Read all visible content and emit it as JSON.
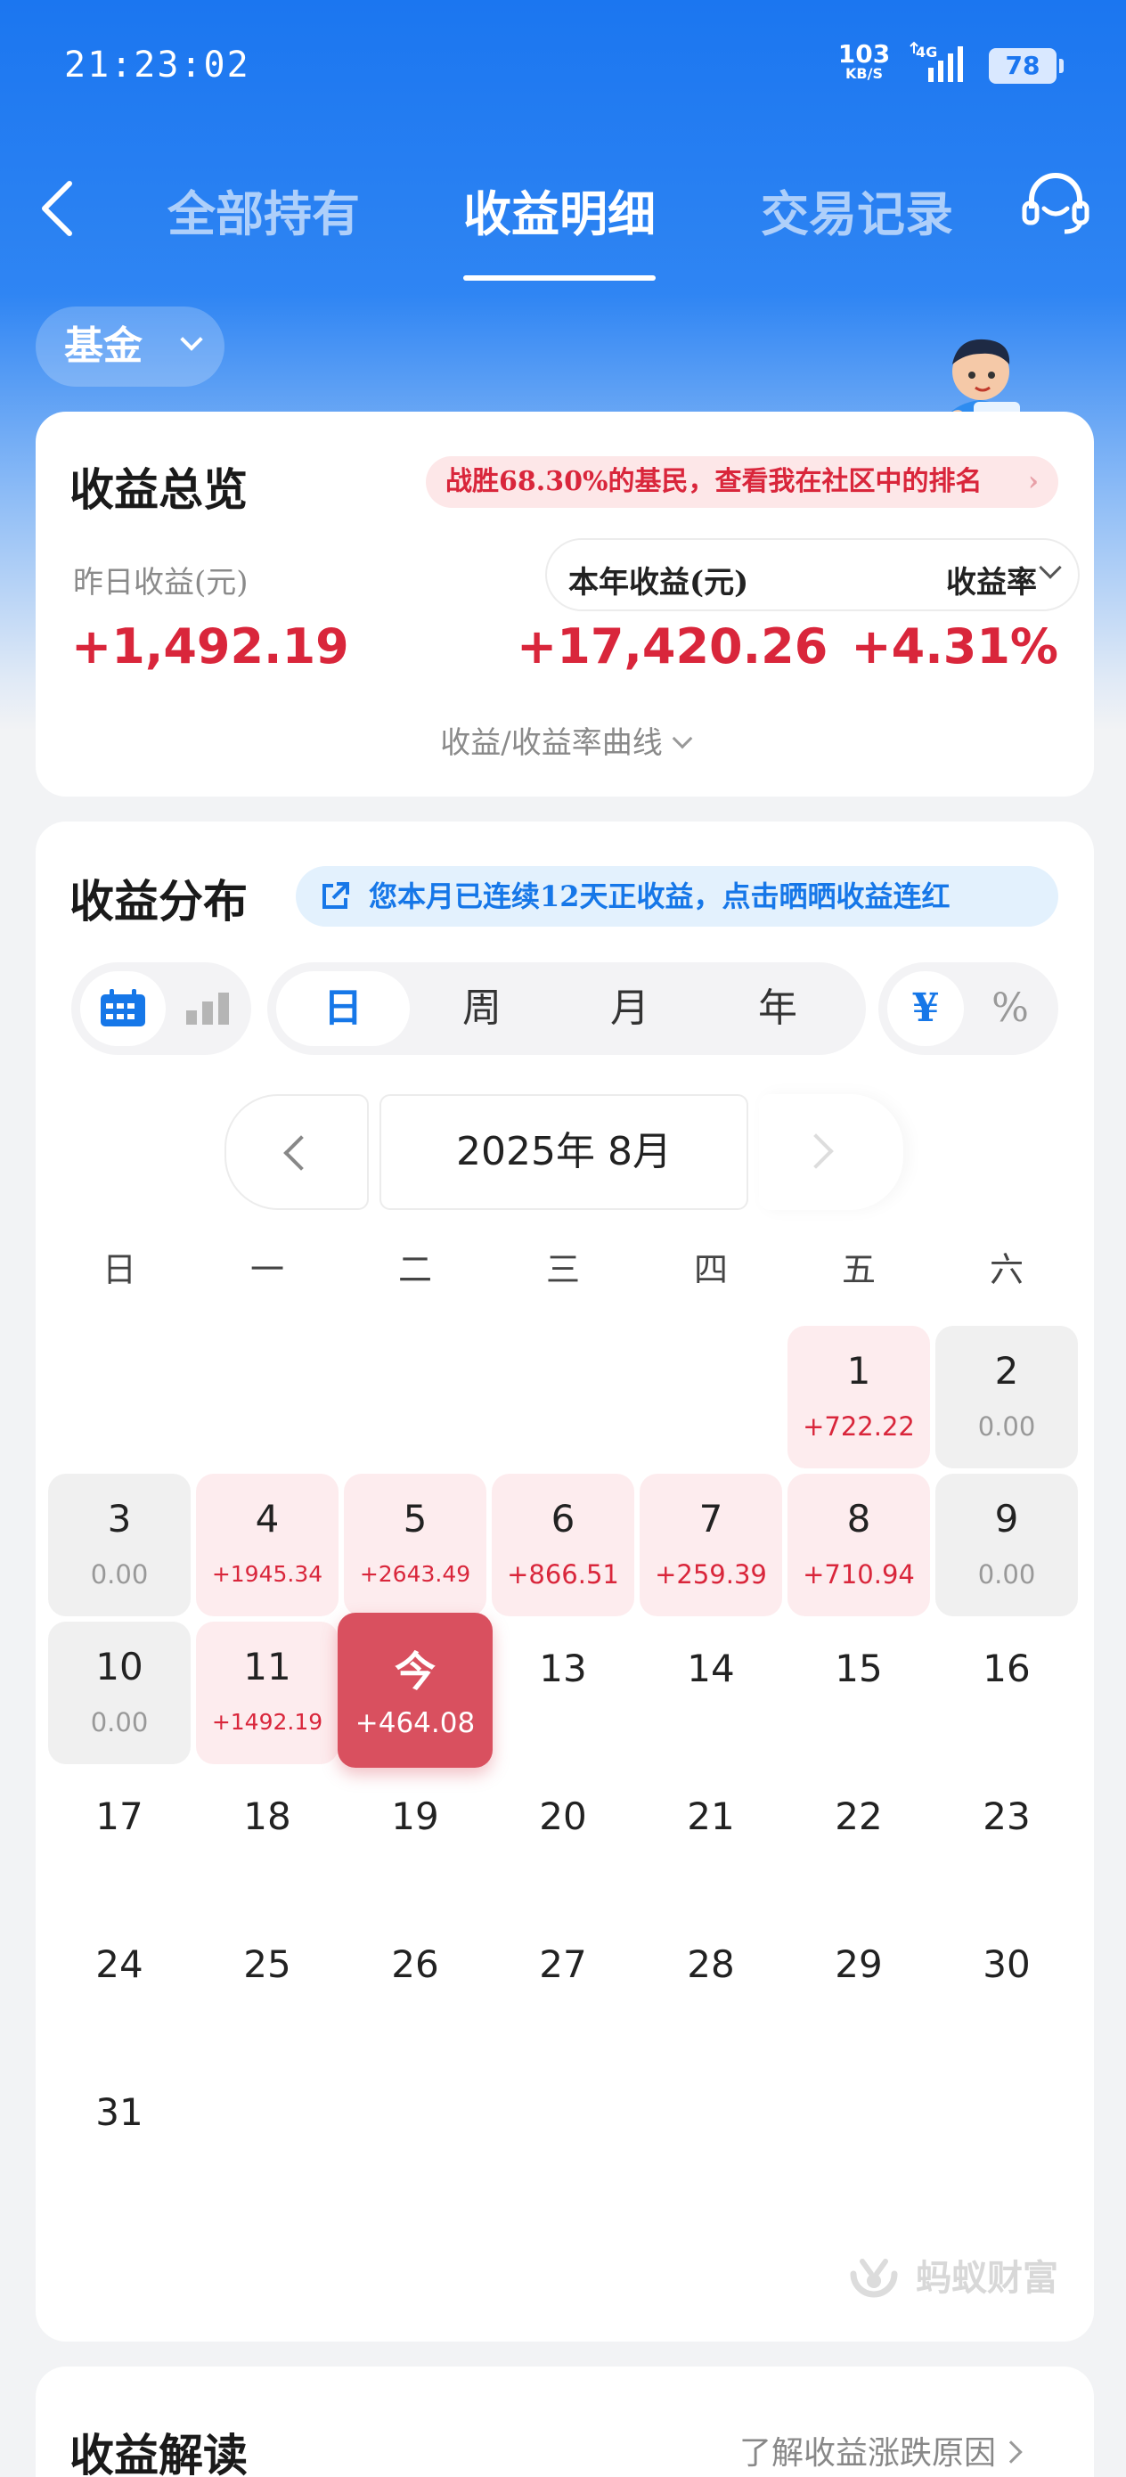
{
  "status": {
    "time": "21:23:02",
    "speed_value": "103",
    "speed_unit": "KB/S",
    "network": "4G",
    "battery": "78"
  },
  "nav": {
    "tabs": [
      "全部持有",
      "收益明细",
      "交易记录"
    ],
    "active_tab": "收益明细"
  },
  "filter": {
    "label": "基金"
  },
  "overview": {
    "title": "收益总览",
    "rank_text": "战胜68.30%的基民，查看我在社区中的排名",
    "yesterday_label": "昨日收益(元)",
    "yesterday_value": "+1,492.19",
    "year_label": "本年收益(元)",
    "year_value": "+17,420.26",
    "rate_label": "收益率",
    "rate_value": "+4.31%",
    "curve_label": "收益/收益率曲线"
  },
  "distribution": {
    "title": "收益分布",
    "streak_text": "您本月已连续12天正收益，点击晒晒收益连红",
    "periods": [
      "日",
      "周",
      "月",
      "年"
    ],
    "active_period": "日",
    "units": [
      "¥",
      "%"
    ],
    "active_unit": "¥",
    "month": "2025年 8月",
    "weekdays": [
      "日",
      "一",
      "二",
      "三",
      "四",
      "五",
      "六"
    ],
    "today_label": "今",
    "cells": [
      {
        "d": "1",
        "v": "+722.22",
        "type": "pos"
      },
      {
        "d": "2",
        "v": "0.00",
        "type": "zero"
      },
      {
        "d": "3",
        "v": "0.00",
        "type": "zero"
      },
      {
        "d": "4",
        "v": "+1945.34",
        "type": "pos"
      },
      {
        "d": "5",
        "v": "+2643.49",
        "type": "pos"
      },
      {
        "d": "6",
        "v": "+866.51",
        "type": "pos"
      },
      {
        "d": "7",
        "v": "+259.39",
        "type": "pos"
      },
      {
        "d": "8",
        "v": "+710.94",
        "type": "pos"
      },
      {
        "d": "9",
        "v": "0.00",
        "type": "zero"
      },
      {
        "d": "10",
        "v": "0.00",
        "type": "zero"
      },
      {
        "d": "11",
        "v": "+1492.19",
        "type": "pos"
      },
      {
        "d": "12",
        "v": "+464.08",
        "type": "today"
      },
      {
        "d": "13",
        "v": "",
        "type": "plain"
      },
      {
        "d": "14",
        "v": "",
        "type": "plain"
      },
      {
        "d": "15",
        "v": "",
        "type": "plain"
      },
      {
        "d": "16",
        "v": "",
        "type": "plain"
      },
      {
        "d": "17",
        "v": "",
        "type": "plain"
      },
      {
        "d": "18",
        "v": "",
        "type": "plain"
      },
      {
        "d": "19",
        "v": "",
        "type": "plain"
      },
      {
        "d": "20",
        "v": "",
        "type": "plain"
      },
      {
        "d": "21",
        "v": "",
        "type": "plain"
      },
      {
        "d": "22",
        "v": "",
        "type": "plain"
      },
      {
        "d": "23",
        "v": "",
        "type": "plain"
      },
      {
        "d": "24",
        "v": "",
        "type": "plain"
      },
      {
        "d": "25",
        "v": "",
        "type": "plain"
      },
      {
        "d": "26",
        "v": "",
        "type": "plain"
      },
      {
        "d": "27",
        "v": "",
        "type": "plain"
      },
      {
        "d": "28",
        "v": "",
        "type": "plain"
      },
      {
        "d": "29",
        "v": "",
        "type": "plain"
      },
      {
        "d": "30",
        "v": "",
        "type": "plain"
      },
      {
        "d": "31",
        "v": "",
        "type": "plain"
      }
    ],
    "brand": "蚂蚁财富"
  },
  "interpret": {
    "title": "收益解读",
    "link": "了解收益涨跌原因"
  },
  "colors": {
    "brand_blue": "#1b76f0",
    "gain_red": "#d9263b",
    "today_red": "#d9505f"
  }
}
